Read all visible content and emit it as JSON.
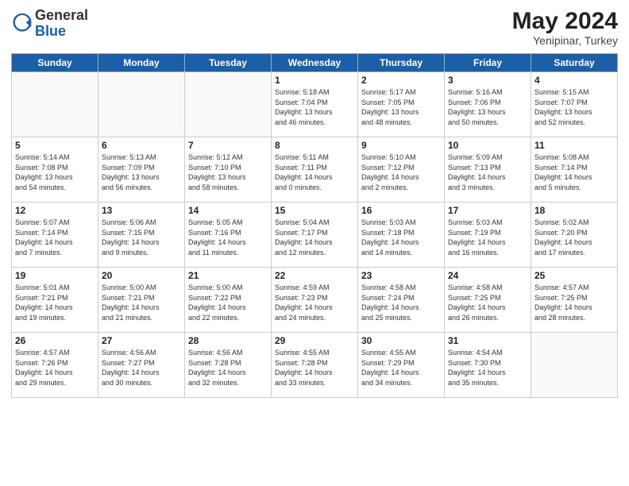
{
  "header": {
    "logo_general": "General",
    "logo_blue": "Blue",
    "month_year": "May 2024",
    "location": "Yenipinar, Turkey"
  },
  "days_of_week": [
    "Sunday",
    "Monday",
    "Tuesday",
    "Wednesday",
    "Thursday",
    "Friday",
    "Saturday"
  ],
  "weeks": [
    [
      {
        "day": "",
        "info": ""
      },
      {
        "day": "",
        "info": ""
      },
      {
        "day": "",
        "info": ""
      },
      {
        "day": "1",
        "info": "Sunrise: 5:18 AM\nSunset: 7:04 PM\nDaylight: 13 hours\nand 46 minutes."
      },
      {
        "day": "2",
        "info": "Sunrise: 5:17 AM\nSunset: 7:05 PM\nDaylight: 13 hours\nand 48 minutes."
      },
      {
        "day": "3",
        "info": "Sunrise: 5:16 AM\nSunset: 7:06 PM\nDaylight: 13 hours\nand 50 minutes."
      },
      {
        "day": "4",
        "info": "Sunrise: 5:15 AM\nSunset: 7:07 PM\nDaylight: 13 hours\nand 52 minutes."
      }
    ],
    [
      {
        "day": "5",
        "info": "Sunrise: 5:14 AM\nSunset: 7:08 PM\nDaylight: 13 hours\nand 54 minutes."
      },
      {
        "day": "6",
        "info": "Sunrise: 5:13 AM\nSunset: 7:09 PM\nDaylight: 13 hours\nand 56 minutes."
      },
      {
        "day": "7",
        "info": "Sunrise: 5:12 AM\nSunset: 7:10 PM\nDaylight: 13 hours\nand 58 minutes."
      },
      {
        "day": "8",
        "info": "Sunrise: 5:11 AM\nSunset: 7:11 PM\nDaylight: 14 hours\nand 0 minutes."
      },
      {
        "day": "9",
        "info": "Sunrise: 5:10 AM\nSunset: 7:12 PM\nDaylight: 14 hours\nand 2 minutes."
      },
      {
        "day": "10",
        "info": "Sunrise: 5:09 AM\nSunset: 7:13 PM\nDaylight: 14 hours\nand 3 minutes."
      },
      {
        "day": "11",
        "info": "Sunrise: 5:08 AM\nSunset: 7:14 PM\nDaylight: 14 hours\nand 5 minutes."
      }
    ],
    [
      {
        "day": "12",
        "info": "Sunrise: 5:07 AM\nSunset: 7:14 PM\nDaylight: 14 hours\nand 7 minutes."
      },
      {
        "day": "13",
        "info": "Sunrise: 5:06 AM\nSunset: 7:15 PM\nDaylight: 14 hours\nand 9 minutes."
      },
      {
        "day": "14",
        "info": "Sunrise: 5:05 AM\nSunset: 7:16 PM\nDaylight: 14 hours\nand 11 minutes."
      },
      {
        "day": "15",
        "info": "Sunrise: 5:04 AM\nSunset: 7:17 PM\nDaylight: 14 hours\nand 12 minutes."
      },
      {
        "day": "16",
        "info": "Sunrise: 5:03 AM\nSunset: 7:18 PM\nDaylight: 14 hours\nand 14 minutes."
      },
      {
        "day": "17",
        "info": "Sunrise: 5:03 AM\nSunset: 7:19 PM\nDaylight: 14 hours\nand 16 minutes."
      },
      {
        "day": "18",
        "info": "Sunrise: 5:02 AM\nSunset: 7:20 PM\nDaylight: 14 hours\nand 17 minutes."
      }
    ],
    [
      {
        "day": "19",
        "info": "Sunrise: 5:01 AM\nSunset: 7:21 PM\nDaylight: 14 hours\nand 19 minutes."
      },
      {
        "day": "20",
        "info": "Sunrise: 5:00 AM\nSunset: 7:21 PM\nDaylight: 14 hours\nand 21 minutes."
      },
      {
        "day": "21",
        "info": "Sunrise: 5:00 AM\nSunset: 7:22 PM\nDaylight: 14 hours\nand 22 minutes."
      },
      {
        "day": "22",
        "info": "Sunrise: 4:59 AM\nSunset: 7:23 PM\nDaylight: 14 hours\nand 24 minutes."
      },
      {
        "day": "23",
        "info": "Sunrise: 4:58 AM\nSunset: 7:24 PM\nDaylight: 14 hours\nand 25 minutes."
      },
      {
        "day": "24",
        "info": "Sunrise: 4:58 AM\nSunset: 7:25 PM\nDaylight: 14 hours\nand 26 minutes."
      },
      {
        "day": "25",
        "info": "Sunrise: 4:57 AM\nSunset: 7:25 PM\nDaylight: 14 hours\nand 28 minutes."
      }
    ],
    [
      {
        "day": "26",
        "info": "Sunrise: 4:57 AM\nSunset: 7:26 PM\nDaylight: 14 hours\nand 29 minutes."
      },
      {
        "day": "27",
        "info": "Sunrise: 4:56 AM\nSunset: 7:27 PM\nDaylight: 14 hours\nand 30 minutes."
      },
      {
        "day": "28",
        "info": "Sunrise: 4:56 AM\nSunset: 7:28 PM\nDaylight: 14 hours\nand 32 minutes."
      },
      {
        "day": "29",
        "info": "Sunrise: 4:55 AM\nSunset: 7:28 PM\nDaylight: 14 hours\nand 33 minutes."
      },
      {
        "day": "30",
        "info": "Sunrise: 4:55 AM\nSunset: 7:29 PM\nDaylight: 14 hours\nand 34 minutes."
      },
      {
        "day": "31",
        "info": "Sunrise: 4:54 AM\nSunset: 7:30 PM\nDaylight: 14 hours\nand 35 minutes."
      },
      {
        "day": "",
        "info": ""
      }
    ]
  ]
}
